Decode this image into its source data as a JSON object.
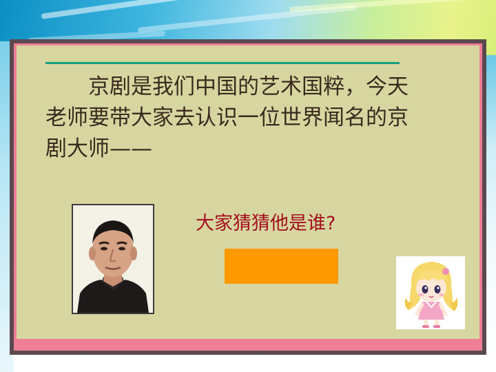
{
  "slide": {
    "intro_text": "京剧是我们中国的艺术国粹，今天老师要带大家去认识一位世界闻名的京剧大师——",
    "question": "大家猜猜他是谁?"
  },
  "colors": {
    "frame_border": "#5a4a4f",
    "panel_pink": "#ee7d96",
    "panel_bg": "#d7d6a0",
    "accent_line": "#12a07a",
    "question_text": "#a40f1f",
    "answer_box": "#ff9900"
  }
}
